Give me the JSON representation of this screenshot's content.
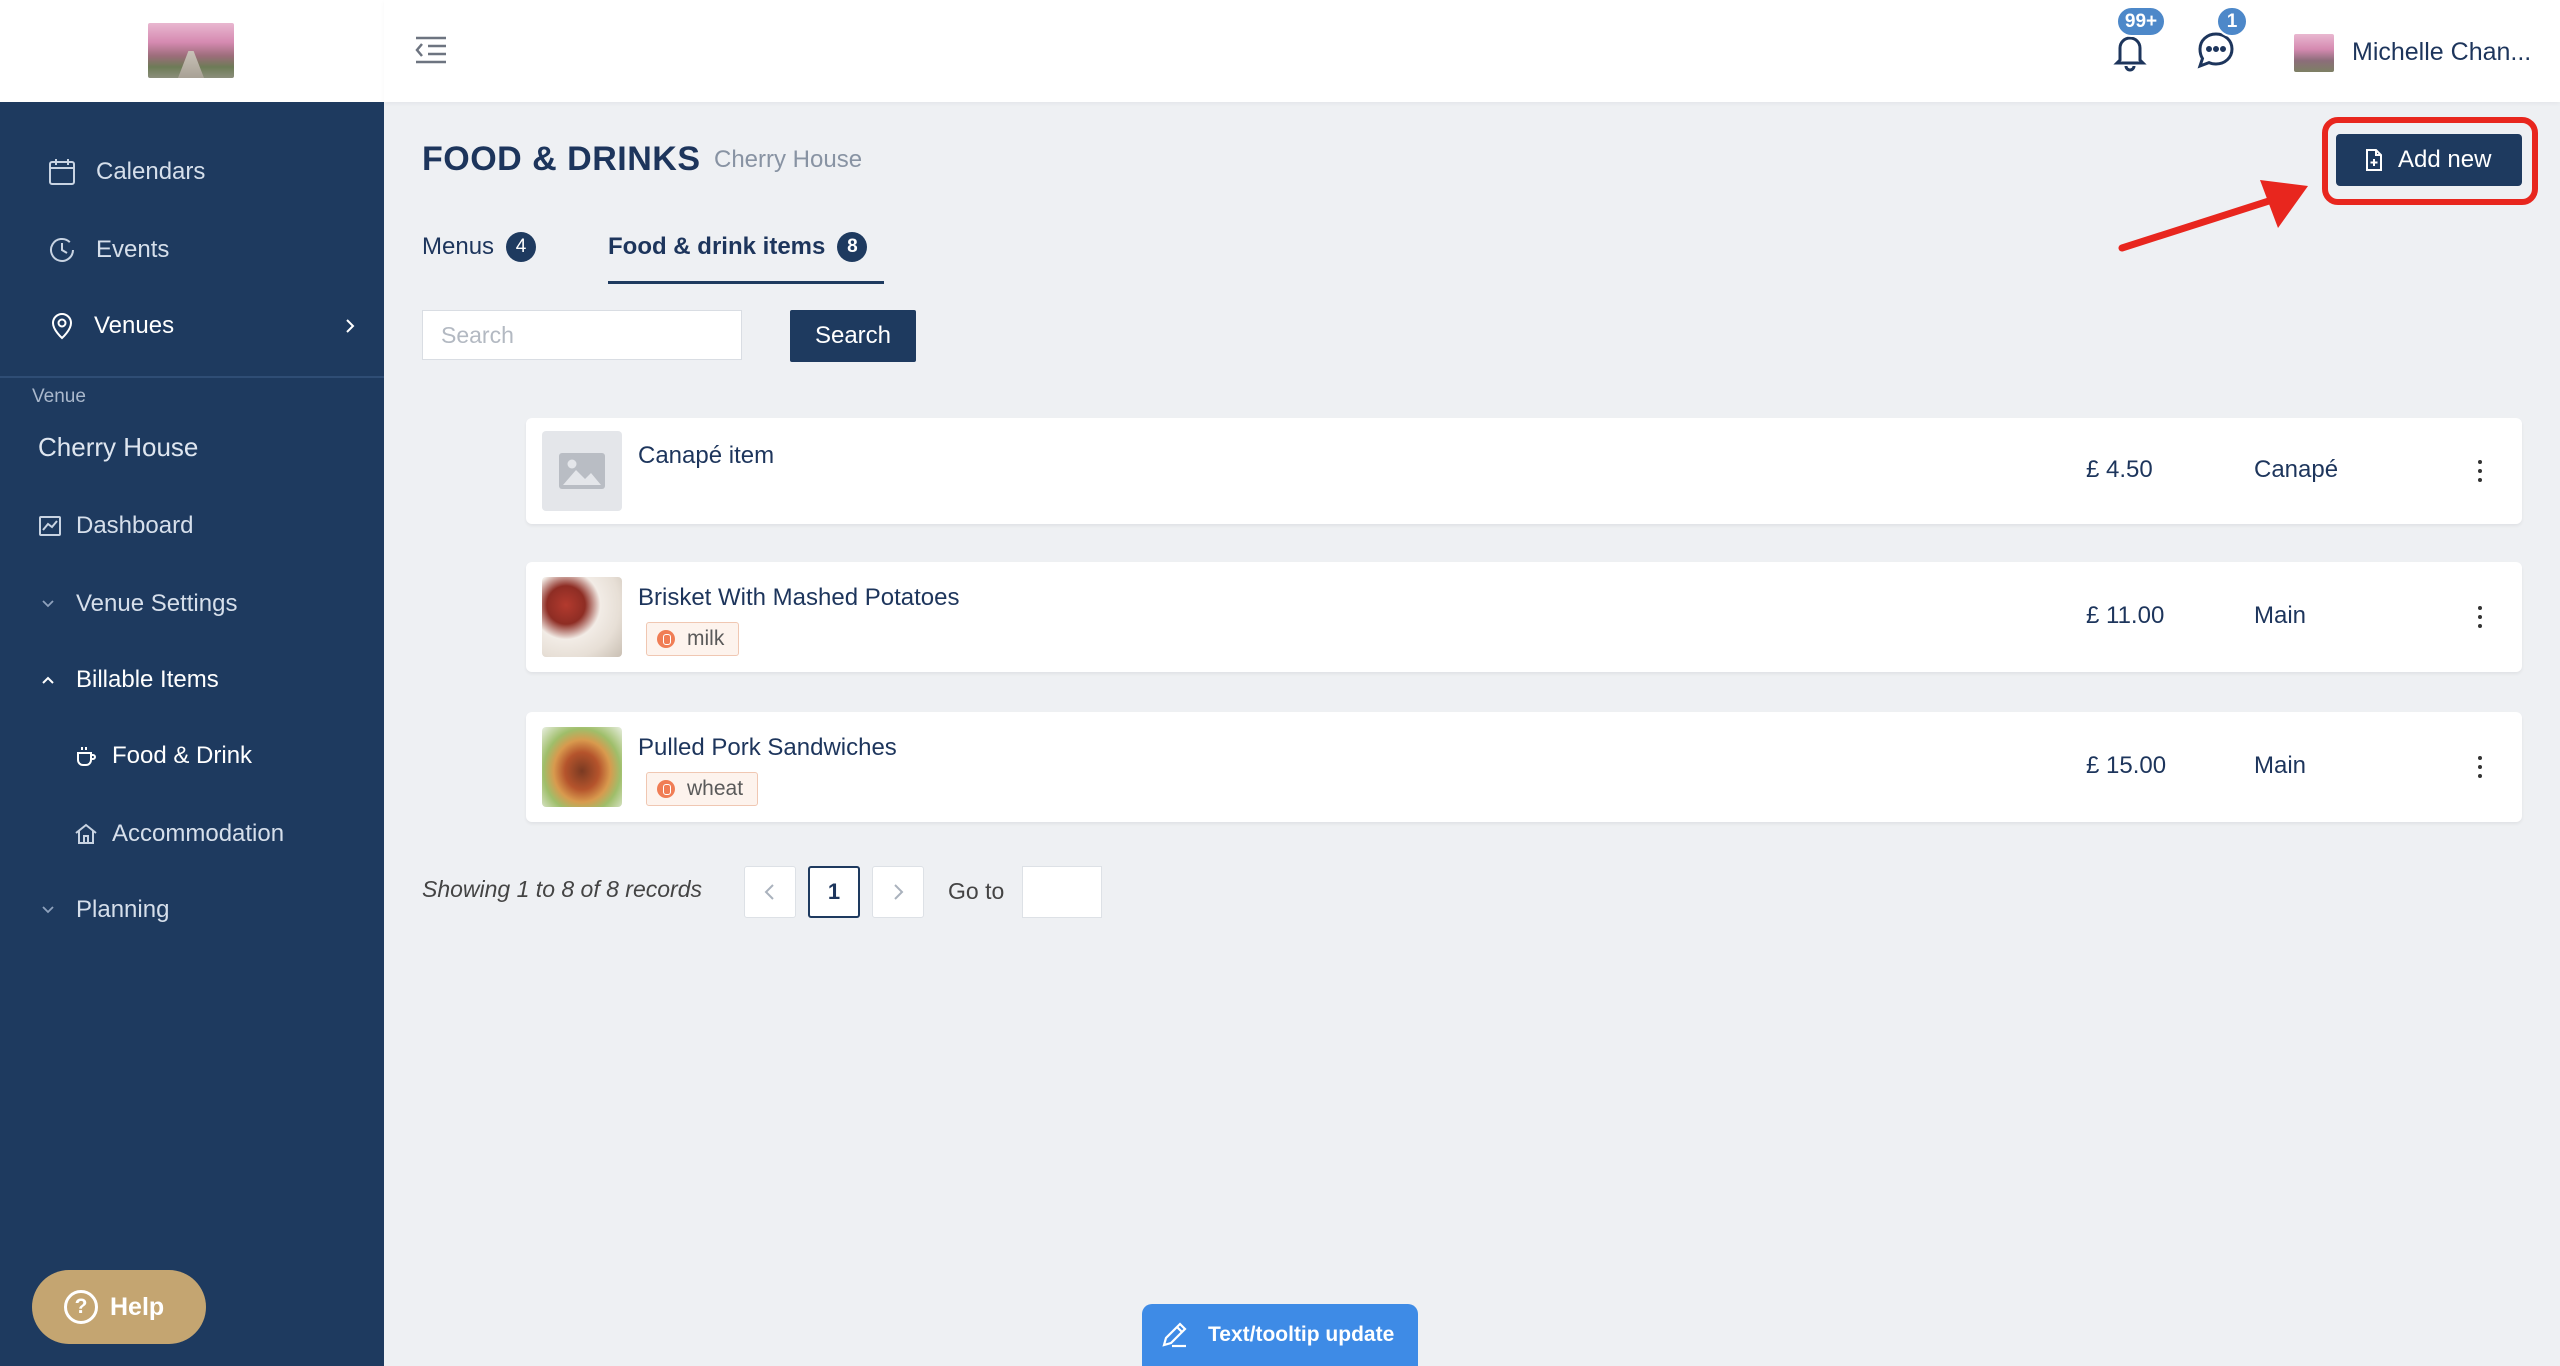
{
  "sidebar": {
    "nav": [
      {
        "label": "Calendars",
        "icon": "calendar-icon"
      },
      {
        "label": "Events",
        "icon": "clock-history-icon"
      },
      {
        "label": "Venues",
        "icon": "location-pin-icon"
      }
    ],
    "venue_caption": "Venue",
    "venue_name": "Cherry House",
    "venue_nav": [
      {
        "label": "Dashboard",
        "icon": "chart-icon"
      },
      {
        "label": "Venue Settings",
        "icon": "chevron-down-icon"
      },
      {
        "label": "Billable Items",
        "icon": "chevron-up-icon"
      },
      {
        "label": "Food & Drink",
        "icon": "coffee-cup-icon"
      },
      {
        "label": "Accommodation",
        "icon": "house-icon"
      },
      {
        "label": "Planning",
        "icon": "chevron-down-icon"
      }
    ],
    "help_label": "Help"
  },
  "topbar": {
    "notifications_badge": "99+",
    "messages_badge": "1",
    "user_name": "Michelle Chan..."
  },
  "page": {
    "title": "FOOD & DRINKS",
    "subtitle": "Cherry House",
    "add_new_label": "Add new",
    "tabs": [
      {
        "label": "Menus",
        "count": "4"
      },
      {
        "label": "Food & drink items",
        "count": "8"
      }
    ],
    "search": {
      "placeholder": "Search",
      "value": "",
      "button_label": "Search"
    }
  },
  "items": [
    {
      "name": "Canapé item",
      "price": "£ 4.50",
      "category": "Canapé",
      "tag": null
    },
    {
      "name": "Brisket With Mashed Potatoes",
      "price": "£ 11.00",
      "category": "Main",
      "tag": "milk"
    },
    {
      "name": "Pulled Pork Sandwiches",
      "price": "£ 15.00",
      "category": "Main",
      "tag": "wheat"
    }
  ],
  "pagination": {
    "summary": "Showing 1 to 8 of 8 records",
    "current_page": "1",
    "goto_label": "Go to",
    "goto_value": ""
  },
  "tooltip_tab_label": "Text/tooltip update",
  "colors": {
    "sidebar": "#1e3a5f",
    "primary": "#1e3a5f",
    "badge": "#4d88c9",
    "highlight": "#e8261e",
    "tag_dot": "#f07d55",
    "help": "#c4a571"
  }
}
